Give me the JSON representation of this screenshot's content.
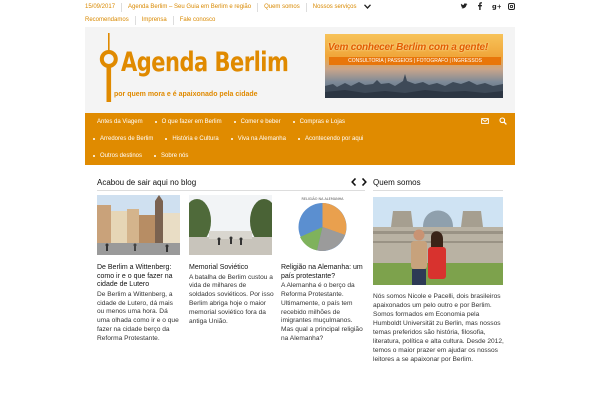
{
  "topbar": {
    "date": "15/09/2017",
    "site_name": "Agenda Berlim – Seu Guia em Berlim e região",
    "menu": [
      "Quem somos",
      "Nossos serviços"
    ],
    "row2": [
      "Recomendamos",
      "Imprensa",
      "Fale conosco"
    ],
    "social_icons": [
      "twitter-icon",
      "facebook-icon",
      "google-plus-icon",
      "instagram-icon"
    ]
  },
  "header": {
    "logo_name": "Agenda Berlim",
    "logo_tagline": "por quem mora e é apaixonado pela cidade",
    "banner_title": "Vem conhecer Berlim com a gente!",
    "banner_services": "CONSULTORIA | PASSEIOS | FOTOGRAFO | INGRESSOS"
  },
  "nav": {
    "row1": [
      "Antes da Viagem",
      "O que fazer em Berlim",
      "Comer e beber",
      "Compras e Lojas"
    ],
    "row2": [
      "Arredores de Berlim",
      "História e Cultura",
      "Viva na Alemanha",
      "Acontecendo por aqui"
    ],
    "row3": [
      "Outros destinos",
      "Sobre nós"
    ],
    "icons": [
      "mail-icon",
      "search-icon"
    ]
  },
  "main": {
    "section_title": "Acabou de sair aqui no blog",
    "posts": [
      {
        "title": "De Berlim a Wittenberg: como ir e o que fazer na cidade de Lutero",
        "excerpt": "De Berlim a Wittenberg, a cidade de Lutero, dá mais ou menos uma hora. Dá uma olhada como ir e o que fazer na cidade berço da Reforma Protestante."
      },
      {
        "title": "Memorial Soviético",
        "excerpt": "A batalha de Berlim custou a vida de milhares de soldados soviéticos. Por isso Berlim abriga hoje o maior memorial soviético fora da antiga União."
      },
      {
        "title": "Religião na Alemanha: um país protestante?",
        "excerpt": "A Alemanha é o berço da Reforma Protestante. Ultimamente, o país tem recebido milhões de imigrantes muçulmanos. Mas qual a principal religião na Alemanha?",
        "chart_caption": "RELIGIÃO NA ALEMANHA"
      }
    ]
  },
  "sidebar": {
    "title": "Quem somos",
    "text": "Nós somos Nicole e Pacelli, dois brasileiros apaixonados um pelo outro e por Berlim. Somos formados em Economia pela Humboldt Universität zu Berlin, mas nossos temas preferidos são história, filosofia, literatura, política e alta cultura. Desde 2012, temos o maior prazer em ajudar os nossos leitores a se apaixonar por Berlim."
  },
  "colors": {
    "accent": "#e08b00",
    "header_bg": "#f4f4f4"
  }
}
